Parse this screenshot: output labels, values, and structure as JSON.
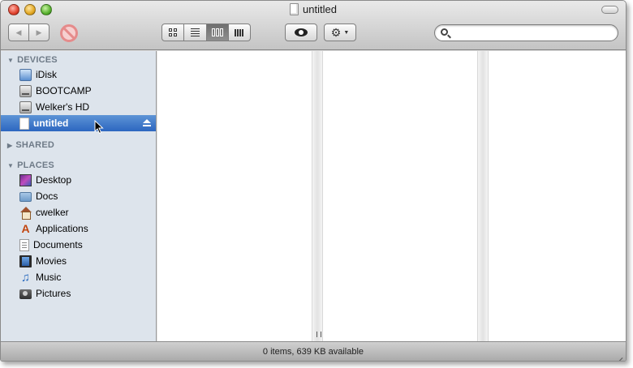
{
  "window": {
    "title": "untitled"
  },
  "toolbar": {
    "back_icon": "back-arrow-icon",
    "forward_icon": "forward-arrow-icon",
    "view_modes": [
      "icon-view",
      "list-view",
      "column-view",
      "cover-flow-view"
    ],
    "active_view": "column-view",
    "search_value": "",
    "search_placeholder": ""
  },
  "sidebar": {
    "devices": {
      "header": "DEVICES",
      "items": [
        {
          "label": "iDisk",
          "icon": "idisk-icon"
        },
        {
          "label": "BOOTCAMP",
          "icon": "drive-icon"
        },
        {
          "label": "Welker's HD",
          "icon": "drive-icon"
        },
        {
          "label": "untitled",
          "icon": "volume-icon",
          "selected": true
        }
      ]
    },
    "shared": {
      "header": "SHARED"
    },
    "places": {
      "header": "PLACES",
      "items": [
        {
          "label": "Desktop",
          "icon": "desktop-icon"
        },
        {
          "label": "Docs",
          "icon": "folder-icon"
        },
        {
          "label": "cwelker",
          "icon": "home-icon"
        },
        {
          "label": "Applications",
          "icon": "applications-icon"
        },
        {
          "label": "Documents",
          "icon": "documents-icon"
        },
        {
          "label": "Movies",
          "icon": "movies-icon"
        },
        {
          "label": "Music",
          "icon": "music-icon"
        },
        {
          "label": "Pictures",
          "icon": "pictures-icon"
        }
      ]
    }
  },
  "status": {
    "text": "0 items, 639 KB available"
  },
  "colors": {
    "selection": "#2c66c0",
    "sidebar_bg": "#dde4ec",
    "section_header": "#6f7b88"
  }
}
